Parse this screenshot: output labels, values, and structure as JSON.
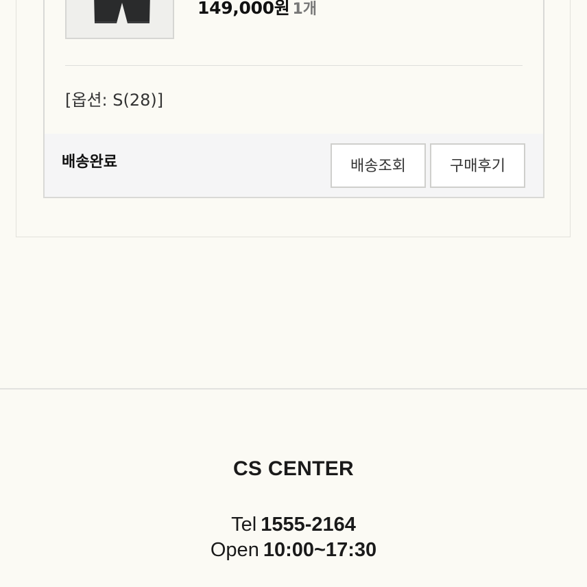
{
  "order_item": {
    "price": "149,000원",
    "quantity": "1개",
    "option": "[옵션: S(28)]",
    "status": "배송완료",
    "track_button": "배송조회",
    "review_button": "구매후기",
    "thumbnail_icon": "product-shorts-image"
  },
  "cs_center": {
    "title": "CS CENTER",
    "tel_label": "Tel",
    "tel_value": "1555-2164",
    "open_label": "Open",
    "open_value": "10:00~17:30"
  },
  "colors": {
    "background": "#fbfaf4",
    "status_bar": "#f5f5f6",
    "text": "#111111",
    "muted": "#777777"
  }
}
